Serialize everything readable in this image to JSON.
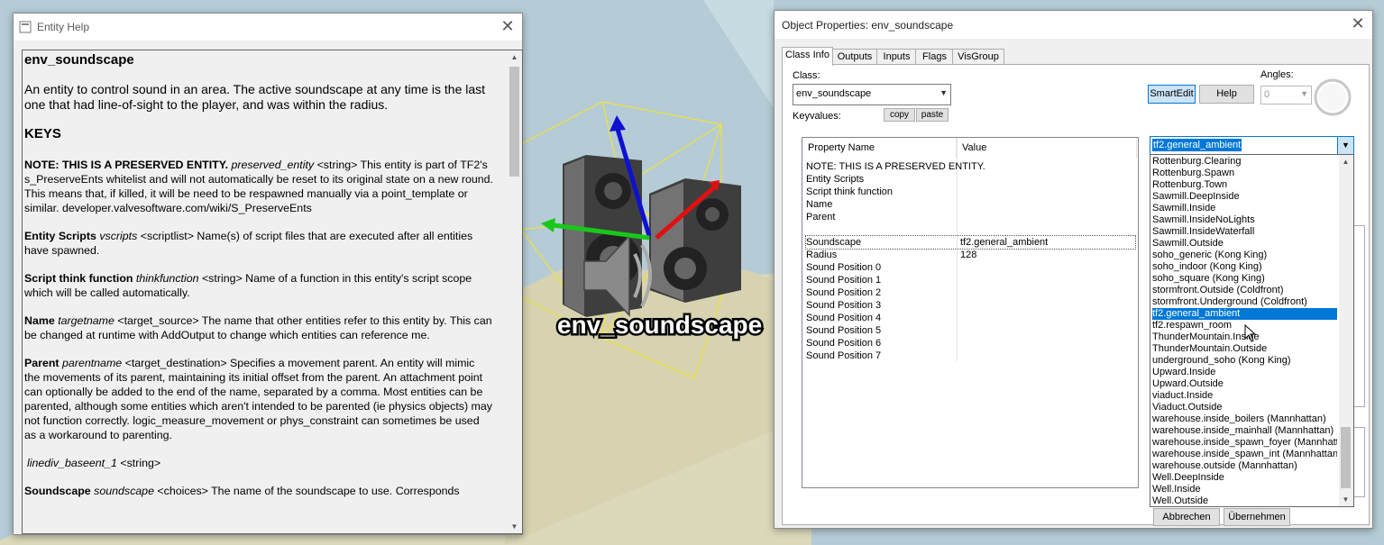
{
  "viewport": {
    "entity_label": "env_soundscape",
    "icon": "speaker-icon"
  },
  "help_window": {
    "title": "Entity Help",
    "heading": "env_soundscape",
    "description": "An entity to control sound in an area. The active soundscape at any time is the last one that had line-of-sight to the player, and was within the radius.",
    "keys_heading": "KEYS",
    "entries": [
      {
        "name": "NOTE: THIS IS A PRESERVED ENTITY.",
        "key": "preserved_entity",
        "text": " <string> This entity is part of TF2's s_PreserveEnts whitelist and will not automatically be reset to its original state on a new round. This means that, if killed, it will be need to be respawned manually via a point_template or similar. developer.valvesoftware.com/wiki/S_PreserveEnts"
      },
      {
        "name": "Entity Scripts",
        "key": "vscripts",
        "text": " <scriptlist> Name(s) of script files that are executed after all entities have spawned."
      },
      {
        "name": "Script think function",
        "key": "thinkfunction",
        "text": " <string> Name of a function in this entity's script scope which will be called automatically."
      },
      {
        "name": "Name",
        "key": "targetname",
        "text": " <target_source> The name that other entities refer to this entity by. This can be changed at runtime with AddOutput to change which entities can reference me."
      },
      {
        "name": "Parent",
        "key": "parentname",
        "text": " <target_destination> Specifies a movement parent. An entity will mimic the movements of its parent, maintaining its initial offset from the parent. An attachment point can optionally be added to the end of the name, separated by a comma. Most entities can be parented, although some entities which aren't intended to be parented (ie physics objects) may not function correctly. logic_measure_movement or phys_constraint can sometimes be used as a workaround to parenting."
      },
      {
        "name": "",
        "key": "linediv_baseent_1",
        "text": " <string>"
      },
      {
        "name": "Soundscape",
        "key": "soundscape",
        "text": " <choices> The name of the soundscape to use. Corresponds"
      }
    ]
  },
  "props_window": {
    "title": "Object Properties: env_soundscape",
    "tabs": [
      "Class Info",
      "Outputs",
      "Inputs",
      "Flags",
      "VisGroup"
    ],
    "active_tab": "Class Info",
    "class_label": "Class:",
    "class_value": "env_soundscape",
    "keyvalues_label": "Keyvalues:",
    "copy_label": "copy",
    "paste_label": "paste",
    "smartedit_label": "SmartEdit",
    "help_label": "Help",
    "angles_label": "Angles:",
    "angles_value": "0",
    "columns": [
      "Property Name",
      "Value"
    ],
    "rows": [
      {
        "name": "NOTE: THIS IS A PRESERVED ENTITY.",
        "value": ""
      },
      {
        "name": "Entity Scripts",
        "value": ""
      },
      {
        "name": "Script think function",
        "value": ""
      },
      {
        "name": "Name",
        "value": ""
      },
      {
        "name": "Parent",
        "value": ""
      },
      {
        "name": "",
        "value": ""
      },
      {
        "name": "Soundscape",
        "value": "tf2.general_ambient"
      },
      {
        "name": "Radius",
        "value": "128"
      },
      {
        "name": "Sound Position 0",
        "value": ""
      },
      {
        "name": "Sound Position 1",
        "value": ""
      },
      {
        "name": "Sound Position 2",
        "value": ""
      },
      {
        "name": "Sound Position 3",
        "value": ""
      },
      {
        "name": "Sound Position 4",
        "value": ""
      },
      {
        "name": "Sound Position 5",
        "value": ""
      },
      {
        "name": "Sound Position 6",
        "value": ""
      },
      {
        "name": "Sound Position 7",
        "value": ""
      }
    ],
    "selected_row": 6,
    "dropdown_value": "tf2.general_ambient",
    "dropdown_items": [
      "Rottenburg.Clearing",
      "Rottenburg.Spawn",
      "Rottenburg.Town",
      "Sawmill.DeepInside",
      "Sawmill.Inside",
      "Sawmill.InsideNoLights",
      "Sawmill.InsideWaterfall",
      "Sawmill.Outside",
      "soho_generic (Kong King)",
      "soho_indoor (Kong King)",
      "soho_square (Kong King)",
      "stormfront.Outside (Coldfront)",
      "stormfront.Underground (Coldfront)",
      "tf2.general_ambient",
      "tf2.respawn_room",
      "ThunderMountain.Inside",
      "ThunderMountain.Outside",
      "underground_soho (Kong King)",
      "Upward.Inside",
      "Upward.Outside",
      "viaduct.Inside",
      "Viaduct.Outside",
      "warehouse.inside_boilers (Mannhattan)",
      "warehouse.inside_mainhall (Mannhattan)",
      "warehouse.inside_spawn_foyer (Mannhatta",
      "warehouse.inside_spawn_int (Mannhattan)",
      "warehouse.outside (Mannhattan)",
      "Well.DeepInside",
      "Well.Inside",
      "Well.Outside"
    ],
    "highlighted_item": "tf2.general_ambient",
    "cancel_label": "Abbrechen",
    "apply_label": "Übernehmen"
  }
}
